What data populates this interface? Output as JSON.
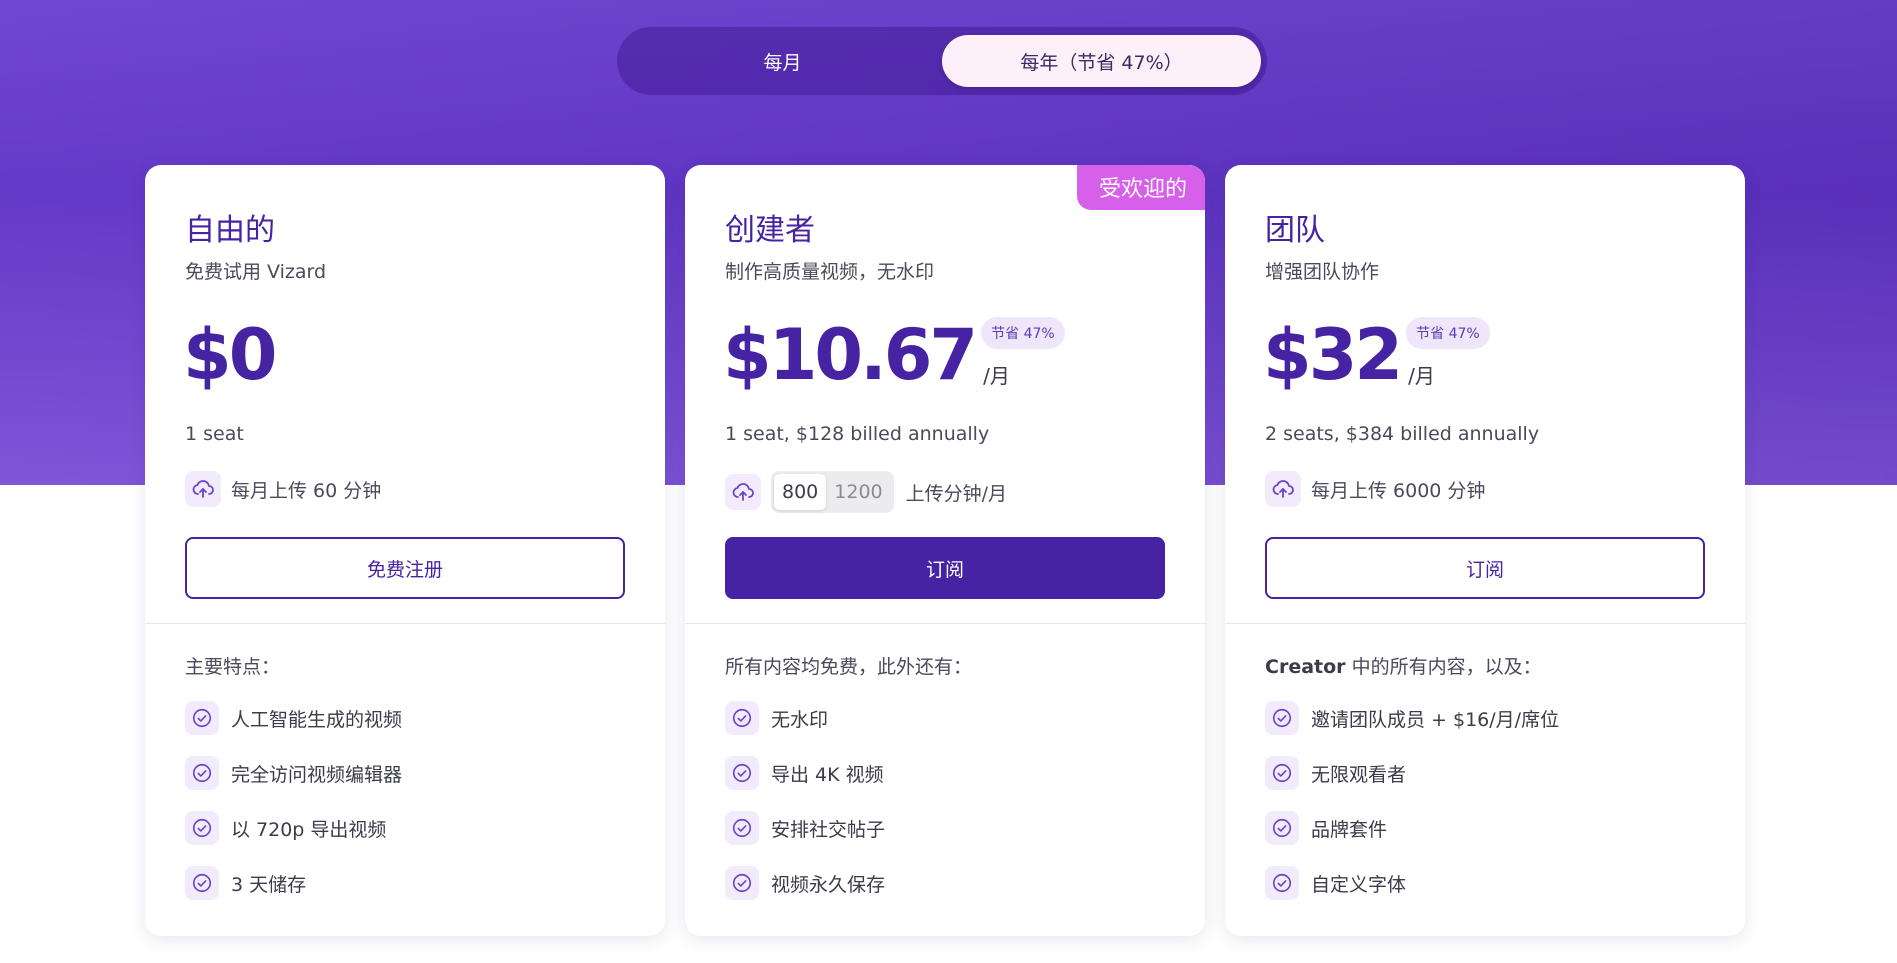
{
  "billing_toggle": {
    "monthly_label": "每月",
    "yearly_label": "每年（节省 47%）",
    "selected": "yearly"
  },
  "plans": [
    {
      "name": "自由的",
      "subtitle": "免费试用 Vizard",
      "price": "$0",
      "seats": "1 seat",
      "upload_label": "每月上传 60 分钟",
      "cta_label": "免费注册",
      "features_heading": "主要特点：",
      "features": [
        "人工智能生成的视频",
        "完全访问视频编辑器",
        "以 720p 导出视频",
        "3 天储存"
      ]
    },
    {
      "name": "创建者",
      "subtitle": "制作高质量视频，无水印",
      "badge": "受欢迎的",
      "price": "$10.67",
      "save_badge": "节省 47%",
      "per_month": "/月",
      "seats": "1 seat, $128 billed annually",
      "upload_options": [
        "800",
        "1200"
      ],
      "upload_selected": "800",
      "upload_suffix": "上传分钟/月",
      "cta_label": "订阅",
      "features_heading": "所有内容均免费，此外还有：",
      "features": [
        "无水印",
        "导出 4K 视频",
        "安排社交帖子",
        "视频永久保存"
      ]
    },
    {
      "name": "团队",
      "subtitle": "增强团队协作",
      "price": "$32",
      "save_badge": "节省 47%",
      "per_month": "/月",
      "seats": "2 seats, $384 billed annually",
      "upload_label": "每月上传 6000 分钟",
      "cta_label": "订阅",
      "features_heading_bold": "Creator",
      "features_heading": " 中的所有内容，以及：",
      "features": [
        "邀请团队成员 + $16/月/席位",
        "无限观看者",
        "品牌套件",
        "自定义字体"
      ]
    }
  ],
  "icons": {
    "upload": "cloud-upload-icon",
    "check": "check-circle-icon"
  },
  "colors": {
    "brand": "#4523a3",
    "hero_bg": "#6a3fd0",
    "popular_badge": "#d760ea",
    "icon_bg": "#f1ebfb"
  }
}
